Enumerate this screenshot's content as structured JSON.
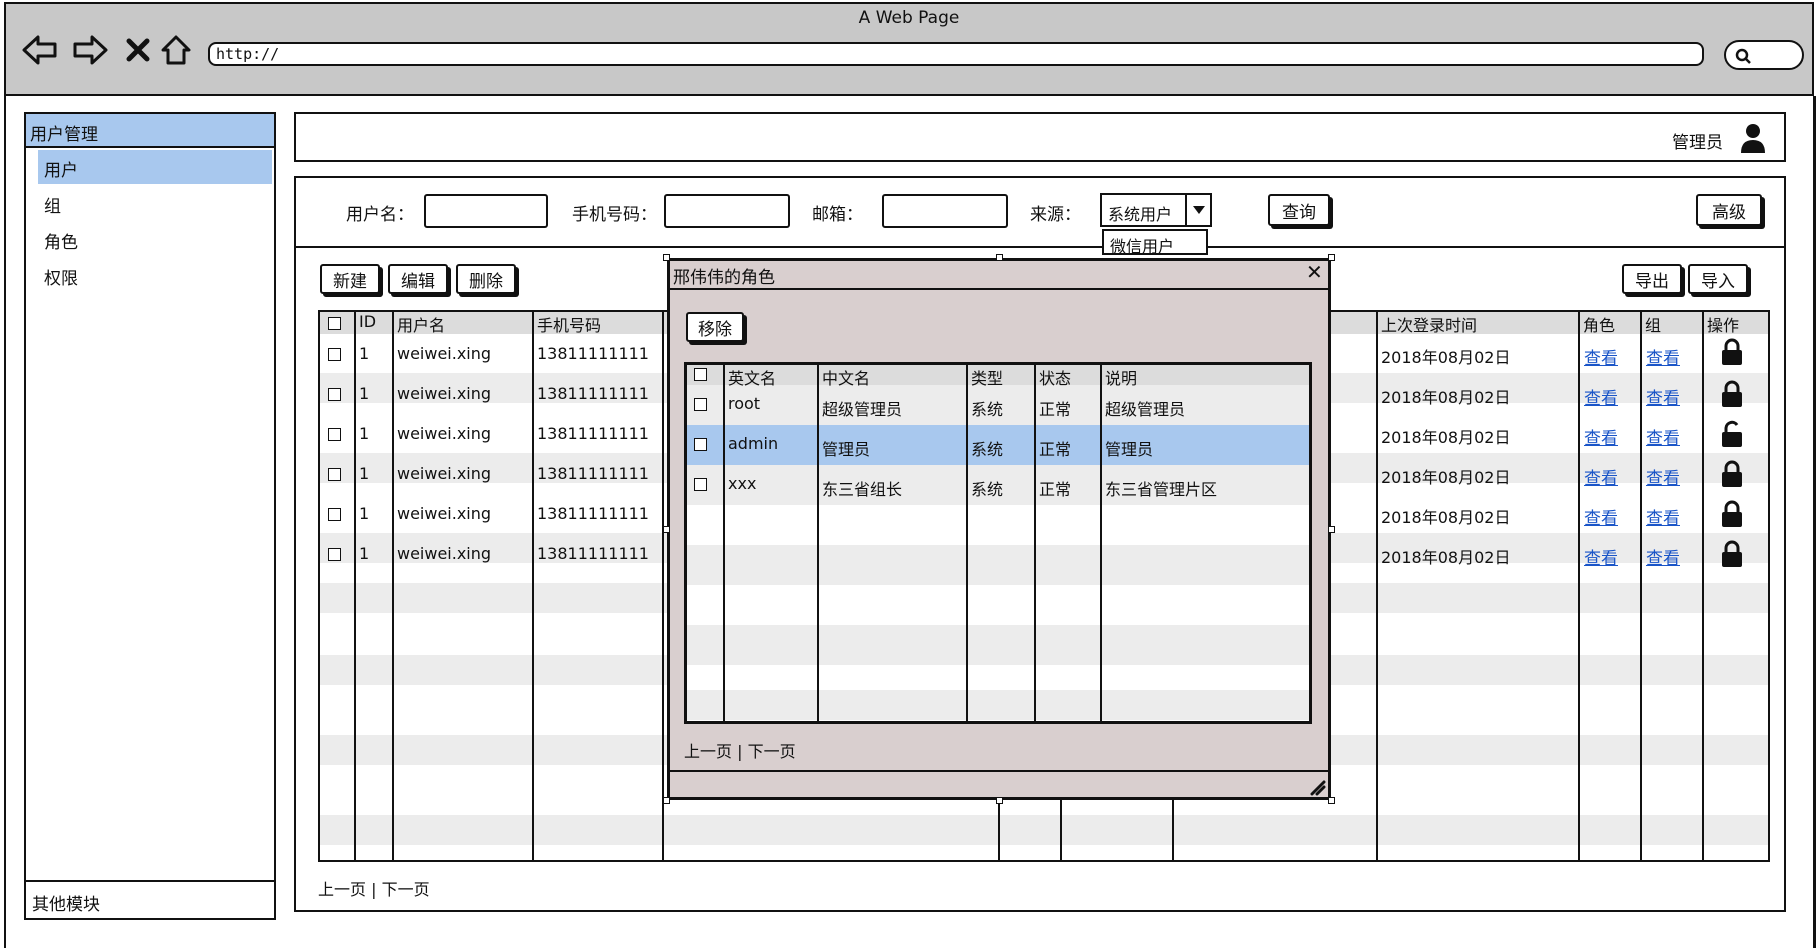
{
  "browser": {
    "title": "A Web Page",
    "url": "http://"
  },
  "sidebar": {
    "header": "用户管理",
    "items": [
      {
        "label": "用户"
      },
      {
        "label": "组"
      },
      {
        "label": "角色"
      },
      {
        "label": "权限"
      }
    ],
    "footer": "其他模块"
  },
  "userbar": {
    "role_label": "管理员"
  },
  "filters": {
    "username_label": "用户名：",
    "phone_label": "手机号码：",
    "email_label": "邮箱：",
    "source_label": "来源：",
    "source_selected": "系统用户",
    "source_options": [
      "微信用户"
    ],
    "query_button": "查询",
    "advanced_button": "高级"
  },
  "toolbar": {
    "new": "新建",
    "edit": "编辑",
    "delete": "删除",
    "export": "导出",
    "import": "导入"
  },
  "table": {
    "headers": {
      "id": "ID",
      "username": "用户名",
      "phone": "手机号码",
      "last_login": "上次登录时间",
      "role": "角色",
      "group": "组",
      "action": "操作"
    },
    "rows": [
      {
        "id": "1",
        "username": "weiwei.xing",
        "phone": "13811111111",
        "last_login": "2018年08月02日",
        "role": "查看",
        "group": "查看",
        "locked": true
      },
      {
        "id": "1",
        "username": "weiwei.xing",
        "phone": "13811111111",
        "last_login": "2018年08月02日",
        "role": "查看",
        "group": "查看",
        "locked": true
      },
      {
        "id": "1",
        "username": "weiwei.xing",
        "phone": "13811111111",
        "last_login": "2018年08月02日",
        "role": "查看",
        "group": "查看",
        "locked": false
      },
      {
        "id": "1",
        "username": "weiwei.xing",
        "phone": "13811111111",
        "last_login": "2018年08月02日",
        "role": "查看",
        "group": "查看",
        "locked": true
      },
      {
        "id": "1",
        "username": "weiwei.xing",
        "phone": "13811111111",
        "last_login": "2018年08月02日",
        "role": "查看",
        "group": "查看",
        "locked": true
      },
      {
        "id": "1",
        "username": "weiwei.xing",
        "phone": "13811111111",
        "last_login": "2018年08月02日",
        "role": "查看",
        "group": "查看",
        "locked": true
      }
    ],
    "pager": "上一页 | 下一页"
  },
  "dialog": {
    "title": "邢伟伟的角色",
    "remove_button": "移除",
    "headers": {
      "en_name": "英文名",
      "cn_name": "中文名",
      "type": "类型",
      "status": "状态",
      "desc": "说明"
    },
    "rows": [
      {
        "en_name": "root",
        "cn_name": "超级管理员",
        "type": "系统",
        "status": "正常",
        "desc": "超级管理员"
      },
      {
        "en_name": "admin",
        "cn_name": "管理员",
        "type": "系统",
        "status": "正常",
        "desc": "管理员"
      },
      {
        "en_name": "xxx",
        "cn_name": "东三省组长",
        "type": "系统",
        "status": "正常",
        "desc": "东三省管理片区"
      }
    ],
    "pager": "上一页 | 下一页"
  },
  "colors": {
    "chrome": "#c8c8c8",
    "highlight": "#a8c8ee",
    "stripe": "#ececec",
    "dialog_bg": "#d9cfcf",
    "link": "#1a55c8"
  }
}
